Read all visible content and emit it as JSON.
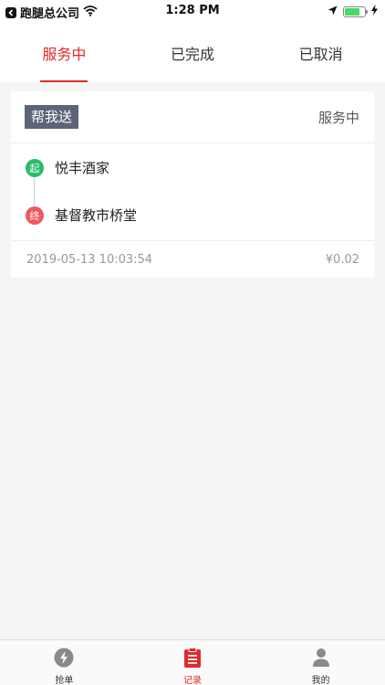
{
  "statusbar": {
    "carrier": "跑腿总公司",
    "time": "1:28 PM"
  },
  "tabs": [
    {
      "label": "服务中",
      "active": true
    },
    {
      "label": "已完成",
      "active": false
    },
    {
      "label": "已取消",
      "active": false
    }
  ],
  "order": {
    "type": "帮我送",
    "status": "服务中",
    "from": {
      "marker": "起",
      "name": "悦丰酒家"
    },
    "to": {
      "marker": "终",
      "name": "基督教市桥堂"
    },
    "datetime": "2019-05-13 10:03:54",
    "price": "¥0.02"
  },
  "tabbar": [
    {
      "label": "抢单",
      "icon": "lightning-icon",
      "active": false
    },
    {
      "label": "记录",
      "icon": "clipboard-list-icon",
      "active": true
    },
    {
      "label": "我的",
      "icon": "person-icon",
      "active": false
    }
  ],
  "colors": {
    "accent": "#e02b2b",
    "badge": "#5b6478",
    "start_marker": "#2dbb6b",
    "end_marker": "#ea5b61",
    "battery": "#4cd964"
  }
}
